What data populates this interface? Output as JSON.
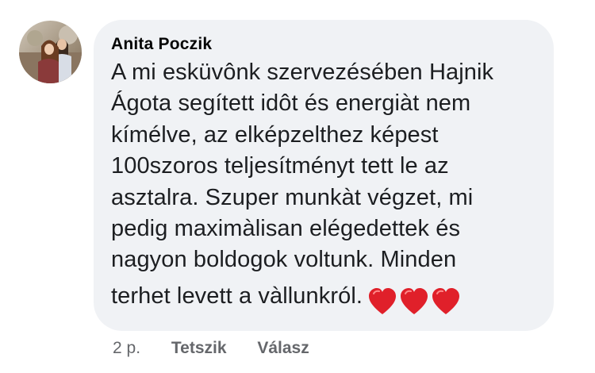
{
  "comment": {
    "author": "Anita Poczik",
    "text_lines": [
      "A mi esküvônk szervezésében Hajnik",
      "Ágota segített idôt és energiàt nem",
      "kímélve, az elképzelthez képest",
      "100szoros teljesítményt tett le az",
      "asztalra. Szuper munkàt végzet, mi",
      "pedig maximàlisan elégedettek és",
      "nagyon boldogok voltunk. Minden",
      "terhet levett a vàllunkról."
    ],
    "emoji": [
      "red-heart",
      "red-heart",
      "red-heart"
    ]
  },
  "actions": {
    "time": "2 p.",
    "like_label": "Tetszik",
    "reply_label": "Válasz"
  },
  "colors": {
    "bubble": "#f0f2f5",
    "text": "#1c1e21",
    "meta": "#65676b",
    "heart": "#e0202a"
  }
}
